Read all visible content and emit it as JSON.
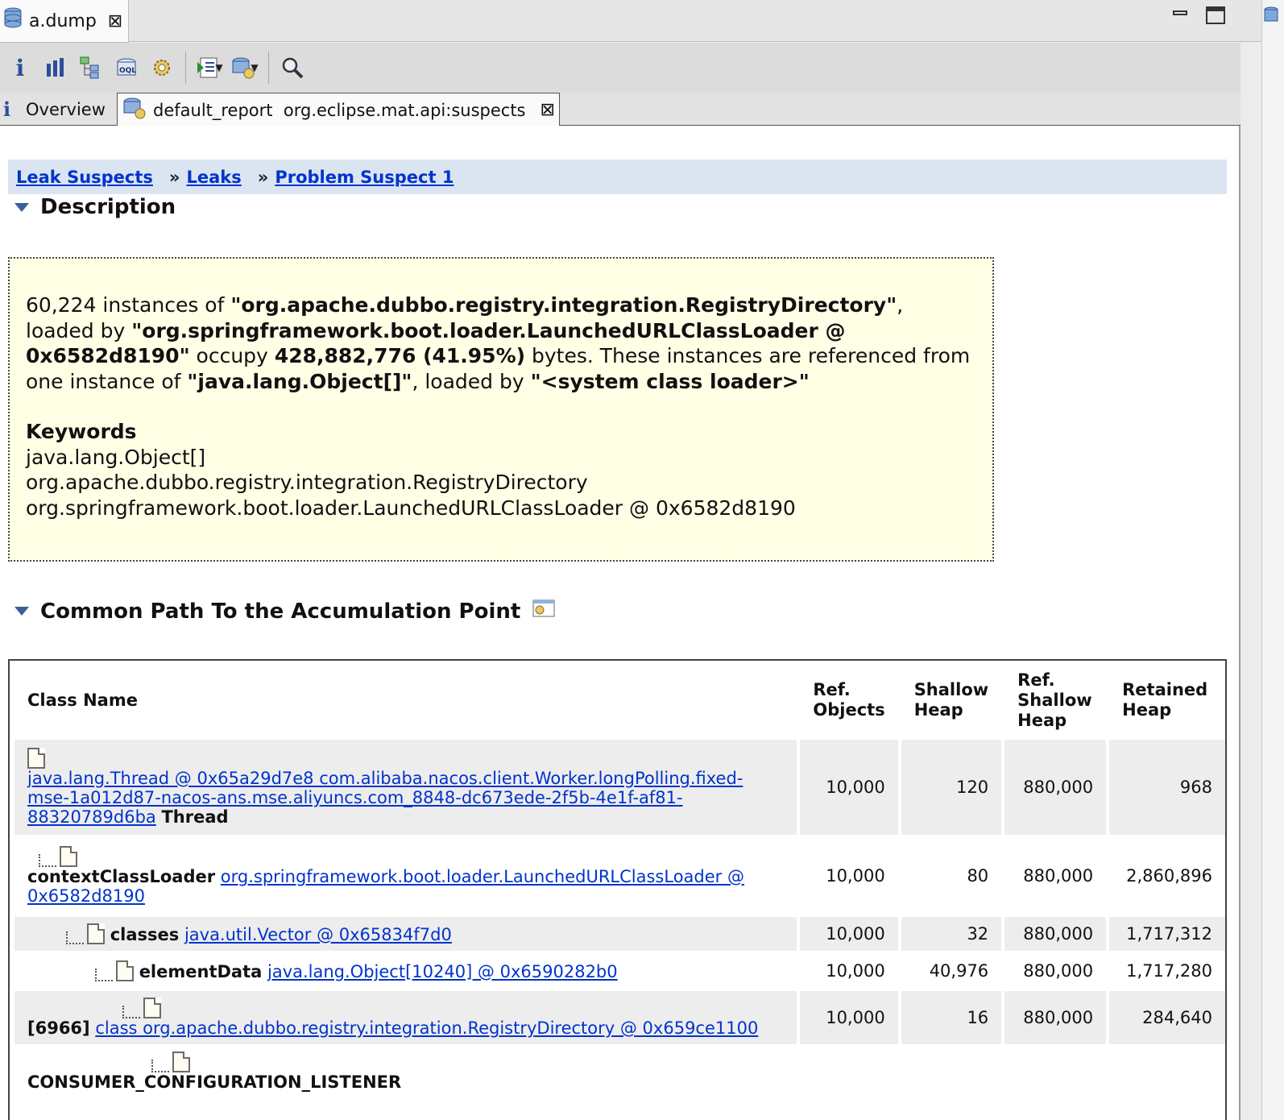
{
  "editor_tab": {
    "title": "a.dump"
  },
  "toolbar": {
    "icons": [
      "info-icon",
      "histogram-icon",
      "dominator-tree-icon",
      "oql-icon",
      "thread-gear-icon",
      "query-browser-icon",
      "heap-dump-gear-icon",
      "search-icon"
    ]
  },
  "inner_tabs": {
    "overview": "Overview",
    "report": "default_report  org.eclipse.mat.api:suspects"
  },
  "breadcrumb": {
    "items": [
      "Leak Suspects",
      "Leaks",
      "Problem Suspect 1"
    ],
    "separator": "»"
  },
  "description": {
    "heading": "Description",
    "p1": "60,224 instances of ",
    "p1b": "\"org.apache.dubbo.registry.integration.RegistryDirectory\"",
    "p2": ", loaded by ",
    "p2b": "\"org.springframework.boot.loader.LaunchedURLClassLoader @ 0x6582d8190\"",
    "p3": " occupy ",
    "p3b": "428,882,776 (41.95%)",
    "p4": " bytes. These instances are referenced from one instance of ",
    "p4b": "\"java.lang.Object[]\"",
    "p5": ", loaded by ",
    "p5b": "\"<system class loader>\"",
    "keywords_title": "Keywords",
    "keywords": [
      "java.lang.Object[]",
      "org.apache.dubbo.registry.integration.RegistryDirectory",
      "org.springframework.boot.loader.LaunchedURLClassLoader @ 0x6582d8190"
    ]
  },
  "path_section": {
    "heading": "Common Path To the Accumulation Point",
    "columns": {
      "class_name": "Class Name",
      "ref_objects": "Ref. Objects",
      "shallow_heap": "Shallow Heap",
      "ref_shallow_heap": "Ref. Shallow Heap",
      "retained_heap": "Retained Heap"
    },
    "rows": [
      {
        "prefix": "",
        "link": "java.lang.Thread @ 0x65a29d7e8 com.alibaba.nacos.client.Worker.longPolling.fixed-mse-1a012d87-nacos-ans.mse.aliyuncs.com_8848-dc673ede-2f5b-4e1f-af81-88320789d6ba",
        "suffix": "Thread",
        "ref_objects": "10,000",
        "shallow_heap": "120",
        "ref_shallow_heap": "880,000",
        "retained_heap": "968"
      },
      {
        "prefix": "contextClassLoader",
        "link": "org.springframework.boot.loader.LaunchedURLClassLoader @ 0x6582d8190",
        "suffix": "",
        "ref_objects": "10,000",
        "shallow_heap": "80",
        "ref_shallow_heap": "880,000",
        "retained_heap": "2,860,896"
      },
      {
        "prefix": "classes",
        "link": "java.util.Vector @ 0x65834f7d0",
        "suffix": "",
        "ref_objects": "10,000",
        "shallow_heap": "32",
        "ref_shallow_heap": "880,000",
        "retained_heap": "1,717,312"
      },
      {
        "prefix": "elementData",
        "link": "java.lang.Object[10240] @ 0x6590282b0",
        "suffix": "",
        "ref_objects": "10,000",
        "shallow_heap": "40,976",
        "ref_shallow_heap": "880,000",
        "retained_heap": "1,717,280"
      },
      {
        "prefix": "[6966]",
        "link": "class org.apache.dubbo.registry.integration.RegistryDirectory @ 0x659ce1100",
        "suffix": "",
        "ref_objects": "10,000",
        "shallow_heap": "16",
        "ref_shallow_heap": "880,000",
        "retained_heap": "284,640"
      },
      {
        "prefix": "CONSUMER_CONFIGURATION_LISTENER",
        "link": "",
        "suffix": "",
        "ref_objects": "",
        "shallow_heap": "",
        "ref_shallow_heap": "",
        "retained_heap": ""
      }
    ]
  }
}
